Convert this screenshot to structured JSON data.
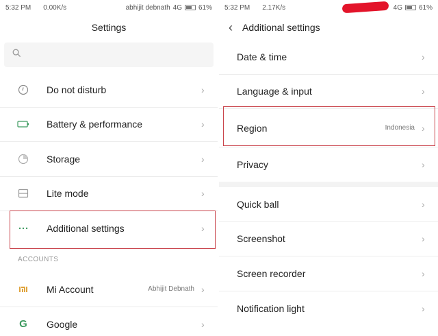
{
  "left": {
    "status": {
      "time": "5:32 PM",
      "speed": "0.00K/s",
      "carrier": "abhijit debnath",
      "network": "4G",
      "battery": "61%"
    },
    "title": "Settings",
    "items": [
      {
        "label": "Do not disturb",
        "icon": "moon-icon"
      },
      {
        "label": "Battery & performance",
        "icon": "battery-icon"
      },
      {
        "label": "Storage",
        "icon": "storage-icon"
      },
      {
        "label": "Lite mode",
        "icon": "lite-mode-icon"
      },
      {
        "label": "Additional settings",
        "icon": "more-dots-icon"
      }
    ],
    "section_header": "ACCOUNTS",
    "accounts": [
      {
        "label": "Mi Account",
        "value": "Abhijit Debnath",
        "icon": "mi-logo-icon"
      },
      {
        "label": "Google",
        "icon": "google-icon"
      }
    ]
  },
  "right": {
    "status": {
      "time": "5:32 PM",
      "speed": "2.17K/s",
      "network": "4G",
      "battery": "61%"
    },
    "title": "Additional settings",
    "items": [
      {
        "label": "Date & time"
      },
      {
        "label": "Language & input"
      },
      {
        "label": "Region",
        "value": "Indonesia"
      },
      {
        "label": "Privacy"
      },
      {
        "label": "Quick ball"
      },
      {
        "label": "Screenshot"
      },
      {
        "label": "Screen recorder"
      },
      {
        "label": "Notification light"
      }
    ]
  },
  "colors": {
    "highlight": "#c9434b",
    "redaction": "#e3142a",
    "google_green": "#3c9a5f",
    "mi_yellow": "#e0a43c"
  }
}
